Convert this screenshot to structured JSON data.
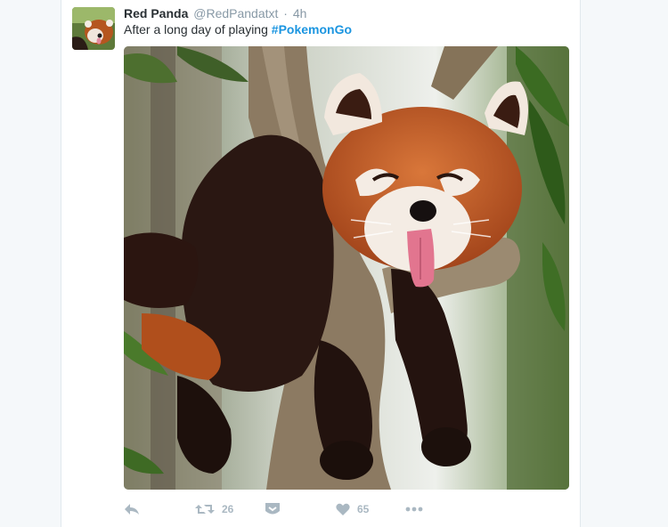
{
  "tweet": {
    "name": "Red Panda",
    "handle": "@RedPandatxt",
    "dot": "·",
    "time": "4h",
    "text": "After a long day of playing",
    "hashtag_symbol": "#",
    "hashtag_word": "PokemonGo",
    "photo": "red-panda-yawning-on-tree-branch"
  },
  "actions": {
    "reply": {
      "icon": "reply-icon"
    },
    "retweet": {
      "icon": "retweet-icon",
      "count": "26"
    },
    "save": {
      "icon": "save-icon"
    },
    "like": {
      "icon": "heart-icon",
      "count": "65"
    },
    "more": {
      "icon": "more-icon"
    }
  },
  "colors": {
    "name": "#292f33",
    "muted": "#8899a6",
    "link": "#1b95e0",
    "action": "#aab8c2",
    "background": "#f5f8fa"
  }
}
